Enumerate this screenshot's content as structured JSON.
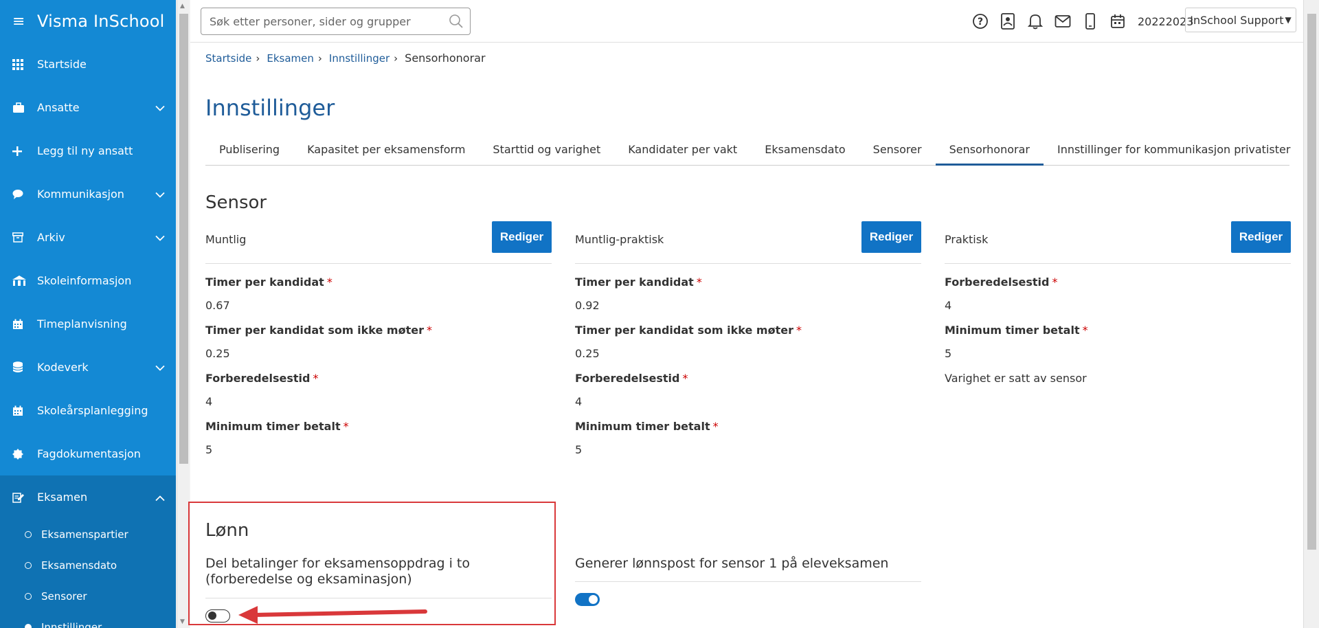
{
  "app": {
    "brand": "Visma InSchool"
  },
  "sidebar": {
    "items": [
      {
        "label": "Startside",
        "icon": "grid-icon",
        "chevron": false
      },
      {
        "label": "Ansatte",
        "icon": "briefcase-icon",
        "chevron": true
      },
      {
        "label": "Legg til ny ansatt",
        "icon": "plus-icon",
        "chevron": false
      },
      {
        "label": "Kommunikasjon",
        "icon": "chat-icon",
        "chevron": true
      },
      {
        "label": "Arkiv",
        "icon": "archive-icon",
        "chevron": true
      },
      {
        "label": "Skoleinformasjon",
        "icon": "school-icon",
        "chevron": false
      },
      {
        "label": "Timeplanvisning",
        "icon": "calendar-icon",
        "chevron": false
      },
      {
        "label": "Kodeverk",
        "icon": "database-icon",
        "chevron": true
      },
      {
        "label": "Skoleårsplanlegging",
        "icon": "calendar-icon",
        "chevron": false
      },
      {
        "label": "Fagdokumentasjon",
        "icon": "badge-icon",
        "chevron": false
      },
      {
        "label": "Eksamen",
        "icon": "exam-icon",
        "chevron": true,
        "expanded": true
      }
    ],
    "subitems": [
      {
        "label": "Eksamenspartier"
      },
      {
        "label": "Eksamensdato"
      },
      {
        "label": "Sensorer"
      },
      {
        "label": "Innstillinger"
      }
    ]
  },
  "topbar": {
    "search_placeholder": "Søk etter personer, sider og grupper",
    "year": "20222023",
    "user": "InSchool Support"
  },
  "breadcrumb": [
    "Startside",
    "Eksamen",
    "Innstillinger",
    "Sensorhonorar"
  ],
  "page_title": "Innstillinger",
  "tabs": [
    "Publisering",
    "Kapasitet per eksamensform",
    "Starttid og varighet",
    "Kandidater per vakt",
    "Eksamensdato",
    "Sensorer",
    "Sensorhonorar",
    "Innstillinger for kommunikasjon privatister"
  ],
  "active_tab": "Sensorhonorar",
  "sensor": {
    "heading": "Sensor",
    "edit_label": "Rediger",
    "columns": [
      {
        "name": "Muntlig",
        "fields": [
          {
            "label": "Timer per kandidat",
            "value": "0.67"
          },
          {
            "label": "Timer per kandidat som ikke møter",
            "value": "0.25"
          },
          {
            "label": "Forberedelsestid",
            "value": "4"
          },
          {
            "label": "Minimum timer betalt",
            "value": "5"
          }
        ]
      },
      {
        "name": "Muntlig-praktisk",
        "fields": [
          {
            "label": "Timer per kandidat",
            "value": "0.92"
          },
          {
            "label": "Timer per kandidat som ikke møter",
            "value": "0.25"
          },
          {
            "label": "Forberedelsestid",
            "value": "4"
          },
          {
            "label": "Minimum timer betalt",
            "value": "5"
          }
        ]
      },
      {
        "name": "Praktisk",
        "fields": [
          {
            "label": "Forberedelsestid",
            "value": "4"
          },
          {
            "label": "Minimum timer betalt",
            "value": "5"
          }
        ],
        "note": "Varighet er satt av sensor"
      }
    ]
  },
  "lonn": {
    "heading": "Lønn",
    "split_label": "Del betalinger for eksamensoppdrag i to (forberedelse og eksaminasjon)",
    "split_on": false,
    "generate_label": "Generer lønnspost for sensor 1 på eleveksamen",
    "generate_on": true
  },
  "colors": {
    "sidebar": "#1489d4",
    "primary_button": "#1173c5",
    "highlight": "#d9383a",
    "link": "#1f5c99"
  }
}
